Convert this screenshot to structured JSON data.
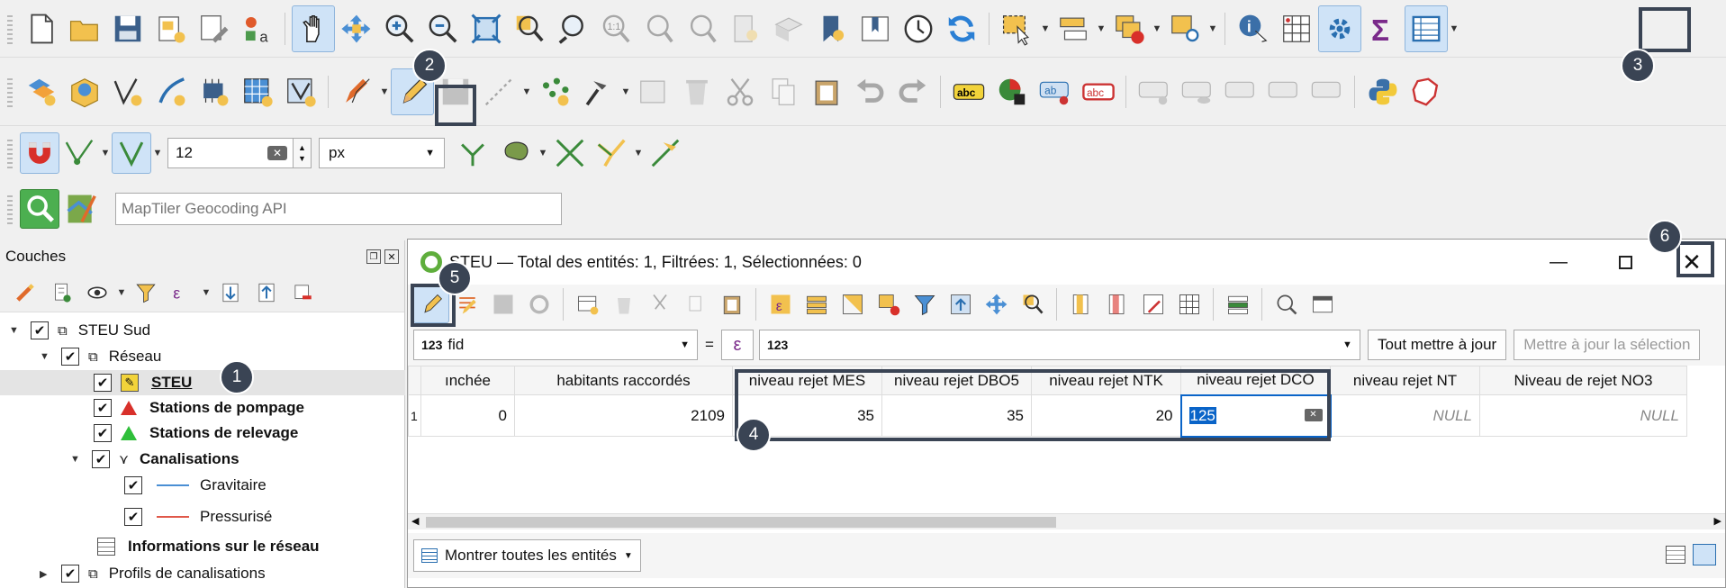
{
  "toolbar1": {
    "icons": [
      "new-project-icon",
      "open-project-icon",
      "save-project-icon",
      "new-print-layout-icon",
      "layout-manager-icon",
      "style-manager-icon",
      "pan-map-icon",
      "pan-to-selection-icon",
      "zoom-in-icon",
      "zoom-out-icon",
      "zoom-full-icon",
      "zoom-to-selection-icon",
      "zoom-to-layer-icon",
      "zoom-native-icon",
      "zoom-last-icon",
      "zoom-next-icon",
      "new-map-view-icon",
      "new-3d-view-icon",
      "new-bookmark-icon",
      "show-bookmarks-icon",
      "temporal-controller-icon",
      "refresh-icon",
      "select-features-icon",
      "select-by-value-icon",
      "deselect-icon",
      "select-by-location-icon",
      "identify-icon",
      "field-calculator-icon",
      "processing-toolbox-icon",
      "statistical-summary-icon",
      "attribute-table-icon"
    ]
  },
  "toolbar2": {
    "icons": [
      "add-layer-icon",
      "virtual-globe-icon",
      "digitize-vertex-icon",
      "digitize-freehand-icon",
      "add-point-icon",
      "add-grid-icon",
      "vertex-tool-icon",
      "current-edits-icon",
      "toggle-editing-icon",
      "save-edits-icon",
      "digitize-line-icon",
      "add-points-icon",
      "vertex-edit-icon",
      "modify-attributes-icon",
      "delete-selected-icon",
      "cut-features-icon",
      "copy-features-icon",
      "paste-features-icon",
      "undo-icon",
      "redo-icon",
      "label-abc-icon",
      "diagram-icon",
      "label-pin-icon",
      "label-highlight-icon",
      "label-move-icon",
      "label-show-icon",
      "label-rotate-icon",
      "label-change-icon",
      "label-rule-icon",
      "python-icon",
      "france-map-icon"
    ]
  },
  "snapping": {
    "tolerance_value": "12",
    "unit": "px"
  },
  "geocoder": {
    "placeholder": "MapTiler Geocoding API"
  },
  "layers_panel": {
    "title": "Couches",
    "tree": [
      {
        "label": "STEU Sud",
        "bold": false
      },
      {
        "label": "Réseau",
        "bold": false
      },
      {
        "label": "STEU",
        "bold": true
      },
      {
        "label": "Stations de pompage",
        "bold": true
      },
      {
        "label": "Stations de relevage",
        "bold": true
      },
      {
        "label": "Canalisations",
        "bold": true
      },
      {
        "label": "Gravitaire",
        "bold": false
      },
      {
        "label": "Pressurisé",
        "bold": false
      },
      {
        "label": "Informations sur le réseau",
        "bold": true
      },
      {
        "label": "Profils de canalisations",
        "bold": false
      }
    ]
  },
  "attribute_dialog": {
    "title": "STEU — Total des entités: 1, Filtrées: 1, Sélectionnées: 0",
    "field_combo": "fid",
    "field_type": "123",
    "equals": "=",
    "expression_value": "123",
    "update_all_button": "Tout mettre à jour",
    "update_selection_button": "Mettre à jour la sélection",
    "columns": [
      "ınchée",
      "habitants raccordés",
      "niveau rejet MES",
      "niveau rejet DBO5",
      "niveau rejet NTK",
      "niveau rejet DCO",
      "niveau rejet NT",
      "Niveau de rejet NO3"
    ],
    "row_number": "1",
    "row": [
      "0",
      "2109",
      "35",
      "35",
      "20",
      "125",
      "NULL",
      "NULL"
    ],
    "show_all_button": "Montrer toutes les entités"
  },
  "callouts": [
    "1",
    "2",
    "3",
    "4",
    "5",
    "6"
  ],
  "colors": {
    "accent": "#3a4454",
    "selection": "#0a64c8"
  }
}
